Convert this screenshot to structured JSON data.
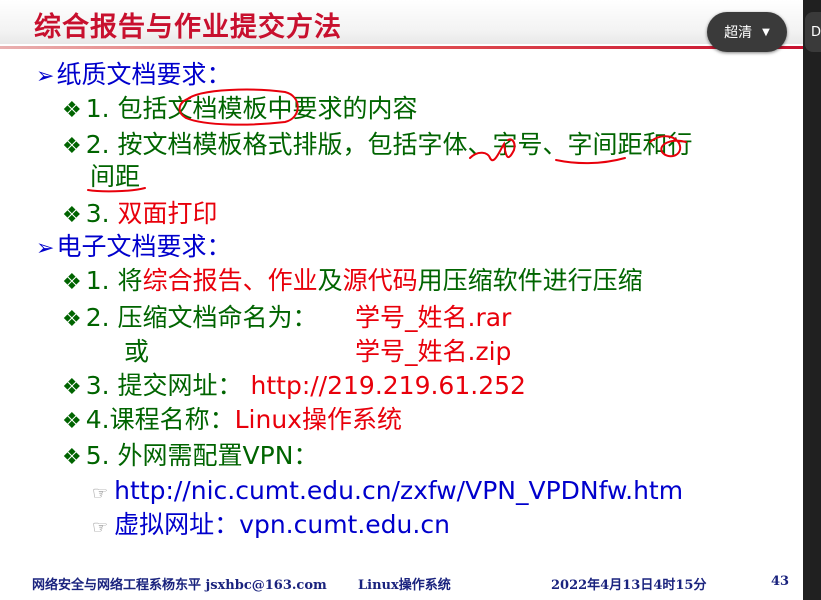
{
  "slide": {
    "title": "综合报告与作业提交方法",
    "sections": [
      {
        "heading": "纸质文档要求：",
        "items": [
          {
            "num": "1.",
            "text": "包括文档模板中要求的内容"
          },
          {
            "num": "2.",
            "text": "按文档模板格式排版，包括字体、字号、字间距和行",
            "text_cont": "间距"
          },
          {
            "num": "3.",
            "text": "双面打印"
          }
        ]
      },
      {
        "heading": "电子文档要求：",
        "items": [
          {
            "num": "1.",
            "pre": "将",
            "r1": "综合报告",
            "sep1": "、",
            "r2": "作业",
            "mid": "及",
            "r3": "源代码",
            "post": "用压缩软件进行压缩"
          },
          {
            "num": "2.",
            "label": "压缩文档命名为：",
            "value": "学号_姓名.rar",
            "or_label": "或",
            "value2": "学号_姓名.zip"
          },
          {
            "num": "3.",
            "label": "提交网址：",
            "value": "http://219.219.61.252"
          },
          {
            "num": "4.",
            "label": "课程名称：",
            "value": "Linux操作系统"
          },
          {
            "num": "5.",
            "label": "外网需配置VPN：",
            "subitems": [
              {
                "text": "http://nic.cumt.edu.cn/zxfw/VPN_VPDNfw.htm"
              },
              {
                "label": "虚拟网址：",
                "value": "vpn.cumt.edu.cn"
              }
            ]
          }
        ]
      }
    ],
    "footer": {
      "left": "网络安全与网络工程系杨东平 jsxhbc@163.com",
      "center": "Linux操作系统",
      "date": "2022年4月13日4时15分",
      "page": "43"
    }
  },
  "player": {
    "quality_label": "超清",
    "edge_label": "D"
  },
  "colors": {
    "title": "#c8102e",
    "body": "#006400",
    "highlight": "#e8000b",
    "heading": "#0000cc",
    "annotation": "#e8000b"
  }
}
